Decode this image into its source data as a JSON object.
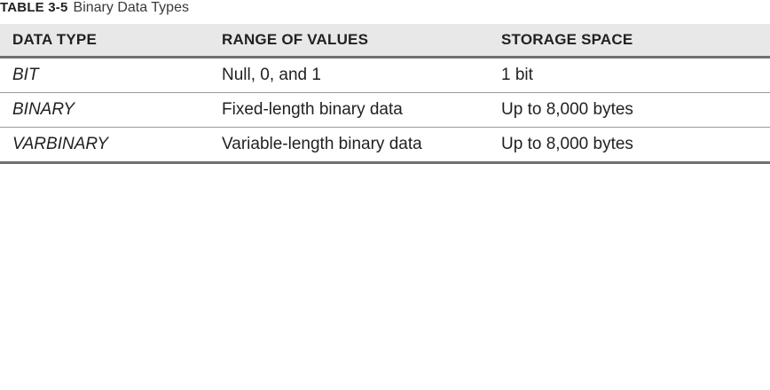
{
  "caption": {
    "number": "TABLE 3-5",
    "title": "Binary Data Types"
  },
  "table": {
    "headers": [
      "DATA TYPE",
      "RANGE OF VALUES",
      "STORAGE SPACE"
    ],
    "rows": [
      [
        "BIT",
        "Null, 0, and 1",
        "1 bit"
      ],
      [
        "BINARY",
        "Fixed-length binary data",
        "Up to 8,000 bytes"
      ],
      [
        "VARBINARY",
        "Variable-length binary data",
        "Up to 8,000 bytes"
      ]
    ]
  }
}
